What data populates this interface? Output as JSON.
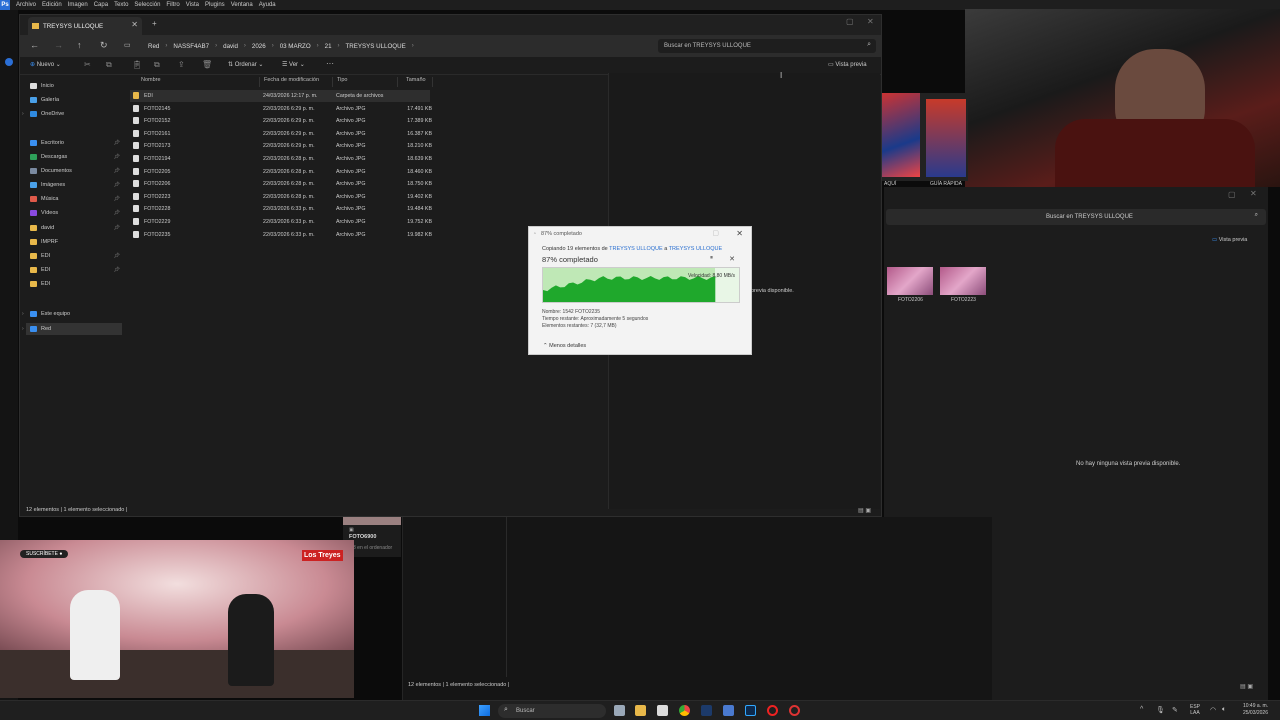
{
  "ps_menu": [
    "Archivo",
    "Edición",
    "Imagen",
    "Capa",
    "Texto",
    "Selección",
    "Filtro",
    "Vista",
    "Plugins",
    "Ventana",
    "Ayuda"
  ],
  "explorer": {
    "tab_title": "TREYSYS ULLOQUE",
    "breadcrumbs": [
      "Red",
      "NASSF4AB7",
      "david",
      "2026",
      "03 MARZO",
      "21",
      "TREYSYS ULLOQUE"
    ],
    "search_placeholder": "Buscar en TREYSYS ULLOQUE",
    "toolbar": {
      "new": "Nuevo",
      "sort": "Ordenar",
      "view": "Ver",
      "more": "···",
      "preview": "Vista previa"
    },
    "sidebar": [
      "Inicio",
      "Galería",
      "OneDrive",
      "Escritorio",
      "Descargas",
      "Documentos",
      "Imágenes",
      "Música",
      "Vídeos",
      "david",
      "IMPRF",
      "EDI",
      "EDI",
      "EDI",
      "Este equipo",
      "Red"
    ],
    "columns": [
      "Nombre",
      "Fecha de modificación",
      "Tipo",
      "Tamaño"
    ],
    "rows": [
      {
        "name": "EDI",
        "date": "24/03/2026 12:17 p. m.",
        "type": "Carpeta de archivos",
        "size": ""
      },
      {
        "name": "FOTO2145",
        "date": "22/03/2026 6:29 p. m.",
        "type": "Archivo JPG",
        "size": "17.491 KB"
      },
      {
        "name": "FOTO2152",
        "date": "22/03/2026 6:29 p. m.",
        "type": "Archivo JPG",
        "size": "17.389 KB"
      },
      {
        "name": "FOTO2161",
        "date": "22/03/2026 6:29 p. m.",
        "type": "Archivo JPG",
        "size": "16.387 KB"
      },
      {
        "name": "FOTO2173",
        "date": "22/03/2026 6:29 p. m.",
        "type": "Archivo JPG",
        "size": "18.210 KB"
      },
      {
        "name": "FOTO2194",
        "date": "22/03/2026 6:28 p. m.",
        "type": "Archivo JPG",
        "size": "18.639 KB"
      },
      {
        "name": "FOTO2205",
        "date": "22/03/2026 6:28 p. m.",
        "type": "Archivo JPG",
        "size": "18.460 KB"
      },
      {
        "name": "FOTO2206",
        "date": "22/03/2026 6:28 p. m.",
        "type": "Archivo JPG",
        "size": "18.750 KB"
      },
      {
        "name": "FOTO2223",
        "date": "22/03/2026 6:28 p. m.",
        "type": "Archivo JPG",
        "size": "19.402 KB"
      },
      {
        "name": "FOTO2228",
        "date": "22/03/2026 6:33 p. m.",
        "type": "Archivo JPG",
        "size": "19.484 KB"
      },
      {
        "name": "FOTO2229",
        "date": "22/03/2026 6:33 p. m.",
        "type": "Archivo JPG",
        "size": "19.752 KB"
      },
      {
        "name": "FOTO2235",
        "date": "22/03/2026 6:33 p. m.",
        "type": "Archivo JPG",
        "size": "19.982 KB"
      }
    ],
    "status": "12 elementos  |  1 elemento seleccionado  |"
  },
  "copy_dialog": {
    "title": "87% completado",
    "desc_prefix": "Copiando 19 elementos de ",
    "from": "TREYSYS ULLOQUE",
    "desc_mid": " a ",
    "to": "TREYSYS ULLOQUE",
    "percent_text": "87% completado",
    "progress": 0.87,
    "speed": "Velocidad: 8,80 MB/s",
    "name_line": "Nombre: 1542 FOTO2235",
    "time_line": "Tiempo restante: Aproximadamente 5 segundos",
    "items_line": "Elementos restantes: 7 (32,7 MB)",
    "less_details": "Menos detalles"
  },
  "explorer2": {
    "search_placeholder": "Buscar en TREYSYS ULLOQUE",
    "preview_label": "Vista previa",
    "thumbs": [
      "FOTO2206",
      "FOTO2223"
    ],
    "no_preview": "No hay ninguna vista previa disponible.",
    "partial_no_preview": "previa disponible.",
    "status": "12 elementos  |  1 elemento seleccionado  |"
  },
  "apps_labels": [
    "AQUÍ",
    "GUÍA RÁPIDA"
  ],
  "ps_file": {
    "name": "FOTO6900",
    "sub": "3 en el ordenador"
  },
  "podcast": {
    "tag": "SUSCRÍBETE ●",
    "logo": "Los Treyes"
  },
  "taskbar": {
    "search": "Buscar",
    "lang": "ESP\nLAA",
    "time": "10:49 a. m.",
    "date": "25/03/2026"
  }
}
